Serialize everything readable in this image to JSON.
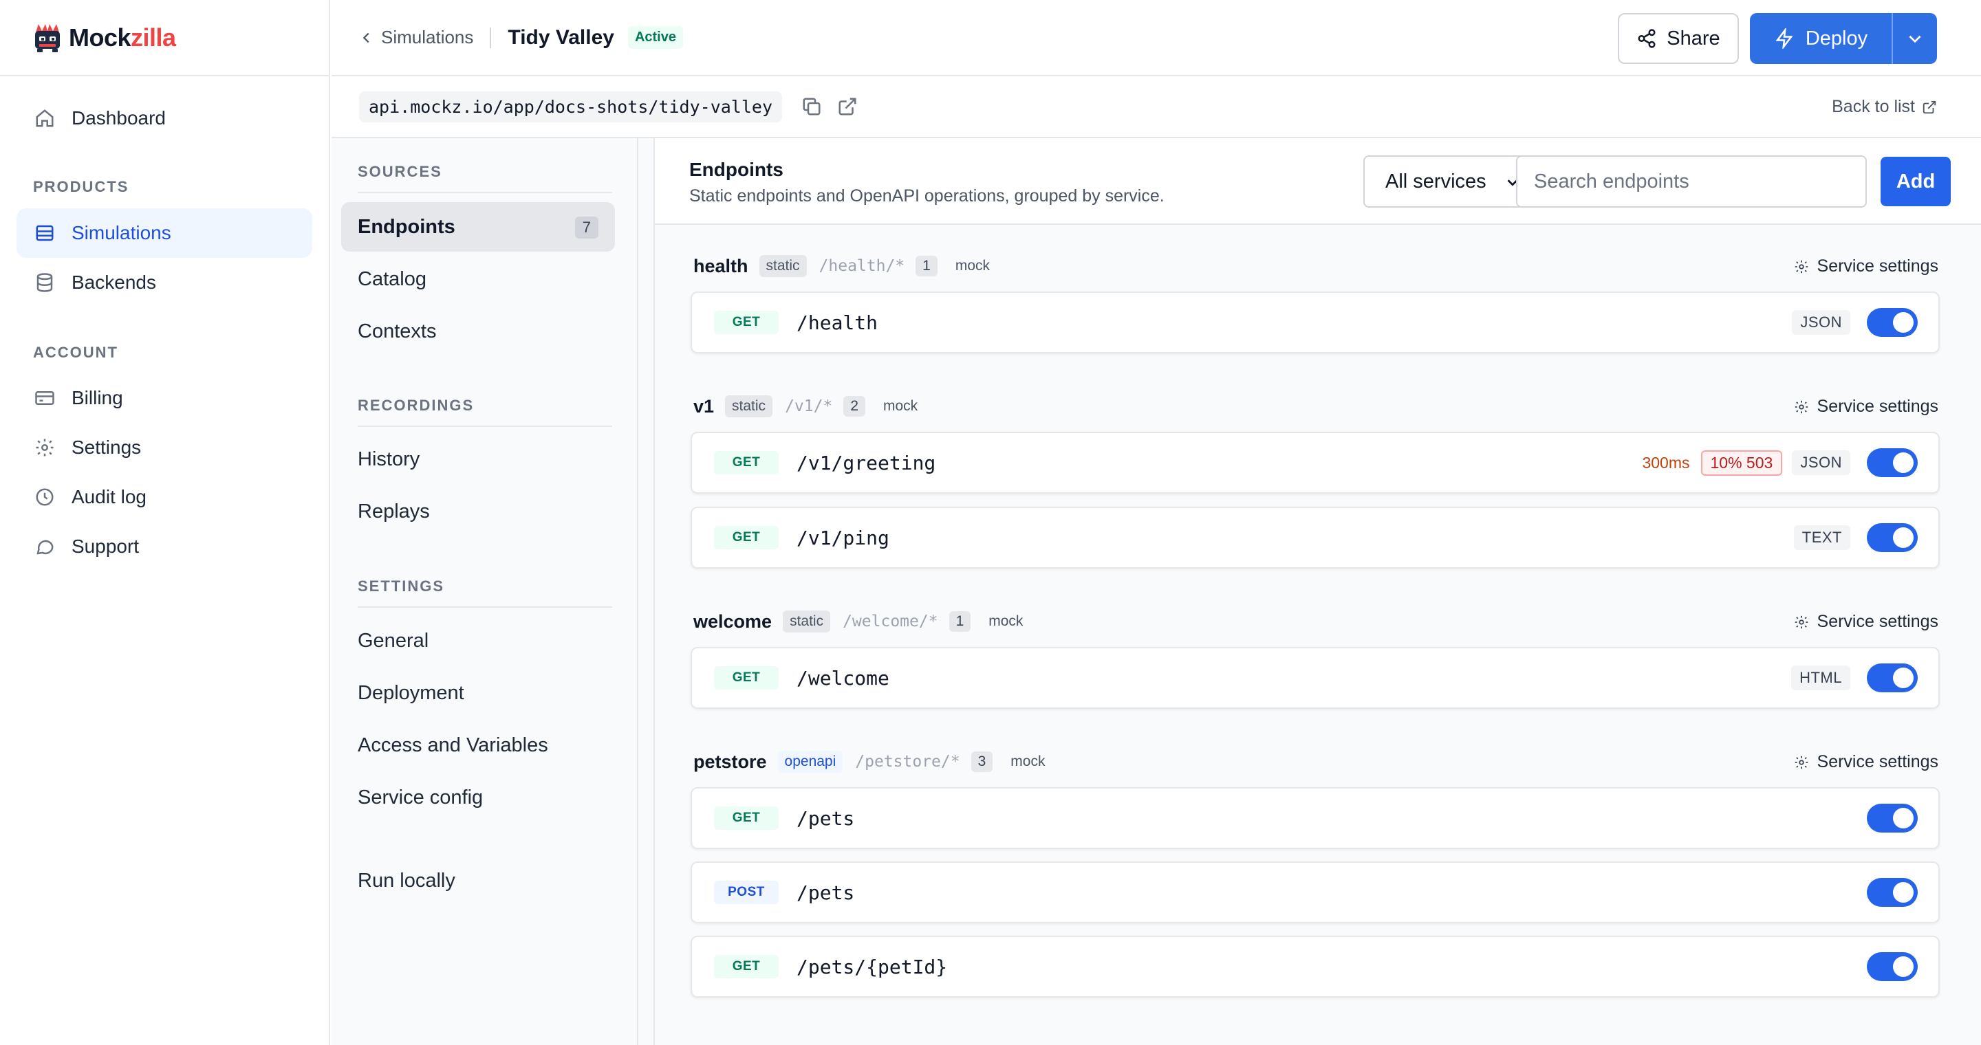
{
  "brand": {
    "name_part1": "Mock",
    "name_part2": "zilla",
    "accent": "#ef4444"
  },
  "sidebar": {
    "top_item": {
      "label": "Dashboard",
      "icon": "home-icon"
    },
    "products_heading": "PRODUCTS",
    "products": [
      {
        "label": "Simulations",
        "icon": "layout-icon",
        "active": true
      },
      {
        "label": "Backends",
        "icon": "database-icon",
        "active": false
      }
    ],
    "account_heading": "ACCOUNT",
    "account": [
      {
        "label": "Billing",
        "icon": "credit-card-icon"
      },
      {
        "label": "Settings",
        "icon": "gear-icon"
      },
      {
        "label": "Audit log",
        "icon": "clock-icon"
      },
      {
        "label": "Support",
        "icon": "chat-icon"
      }
    ]
  },
  "header": {
    "breadcrumb_back": "Simulations",
    "title": "Tidy Valley",
    "status": "Active",
    "share_label": "Share",
    "deploy_label": "Deploy"
  },
  "urlbar": {
    "url": "api.mockz.io/app/docs-shots/tidy-valley",
    "back_to_list": "Back to list"
  },
  "subnav": {
    "sources_heading": "SOURCES",
    "sources": [
      {
        "label": "Endpoints",
        "count": "7",
        "active": true
      },
      {
        "label": "Catalog"
      },
      {
        "label": "Contexts"
      }
    ],
    "recordings_heading": "RECORDINGS",
    "recordings": [
      {
        "label": "History"
      },
      {
        "label": "Replays"
      }
    ],
    "settings_heading": "SETTINGS",
    "settings": [
      {
        "label": "General"
      },
      {
        "label": "Deployment"
      },
      {
        "label": "Access and Variables"
      },
      {
        "label": "Service config"
      }
    ],
    "run_locally": "Run locally"
  },
  "endpoints": {
    "title": "Endpoints",
    "subtitle": "Static endpoints and OpenAPI operations, grouped by service.",
    "filter_value": "All services",
    "search_placeholder": "Search endpoints",
    "add_label": "Add",
    "service_settings_label": "Service settings",
    "services": [
      {
        "name": "health",
        "type": "static",
        "path": "/health/*",
        "count": "1",
        "mode": "mock",
        "endpoints": [
          {
            "method": "GET",
            "path": "/health",
            "format": "JSON",
            "enabled": true
          }
        ]
      },
      {
        "name": "v1",
        "type": "static",
        "path": "/v1/*",
        "count": "2",
        "mode": "mock",
        "endpoints": [
          {
            "method": "GET",
            "path": "/v1/greeting",
            "latency": "300ms",
            "fault": "10% 503",
            "format": "JSON",
            "enabled": true
          },
          {
            "method": "GET",
            "path": "/v1/ping",
            "format": "TEXT",
            "enabled": true
          }
        ]
      },
      {
        "name": "welcome",
        "type": "static",
        "path": "/welcome/*",
        "count": "1",
        "mode": "mock",
        "endpoints": [
          {
            "method": "GET",
            "path": "/welcome",
            "format": "HTML",
            "enabled": true
          }
        ]
      },
      {
        "name": "petstore",
        "type": "openapi",
        "path": "/petstore/*",
        "count": "3",
        "mode": "mock",
        "endpoints": [
          {
            "method": "GET",
            "path": "/pets",
            "enabled": true
          },
          {
            "method": "POST",
            "path": "/pets",
            "enabled": true
          },
          {
            "method": "GET",
            "path": "/pets/{petId}",
            "enabled": true
          }
        ]
      }
    ]
  },
  "colors": {
    "primary": "#2563eb",
    "success": "#047857",
    "danger": "#b91c1c",
    "warning": "#c2410c"
  }
}
